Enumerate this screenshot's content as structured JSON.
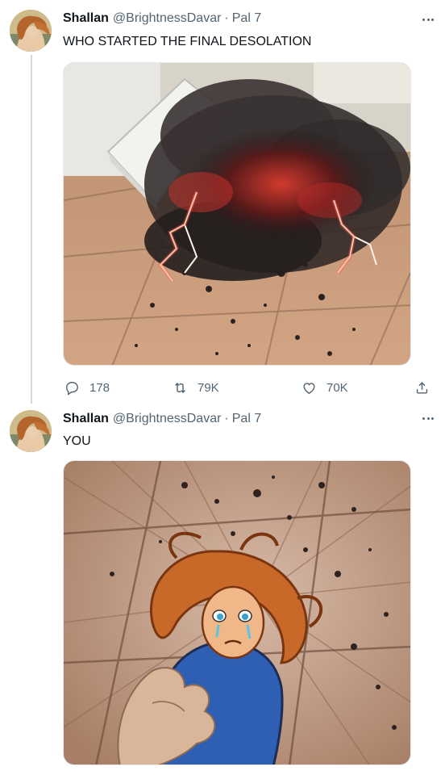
{
  "tweets": [
    {
      "author": {
        "display_name": "Shallan",
        "handle": "@BrightnessDavar",
        "separator": "·",
        "date": "Pal 7"
      },
      "text": "WHO STARTED THE FINAL DESOLATION",
      "media": {
        "description_icon": "photo-icon"
      },
      "actions": {
        "replies": "178",
        "retweets": "79K",
        "likes": "70K"
      }
    },
    {
      "author": {
        "display_name": "Shallan",
        "handle": "@BrightnessDavar",
        "separator": "·",
        "date": "Pal 7"
      },
      "text": "YOU",
      "media": {
        "description_icon": "photo-icon"
      }
    }
  ],
  "colors": {
    "text": "#0f1419",
    "secondary": "#536471",
    "thread_line": "#cfd9de",
    "storm_red": "#c0262b",
    "floor": "#c69a78"
  }
}
